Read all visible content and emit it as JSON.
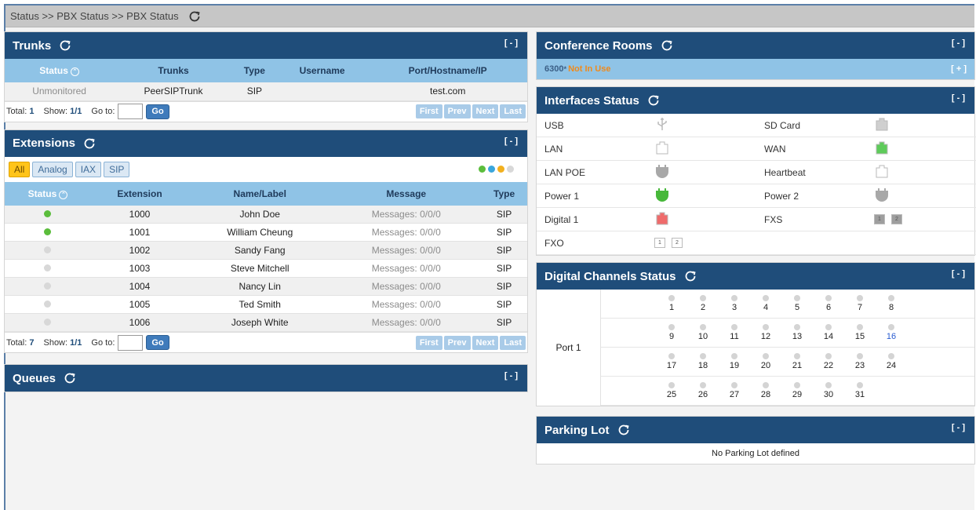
{
  "breadcrumb": "Status >> PBX Status >> PBX Status",
  "toggle_collapse": "[ - ]",
  "toggle_expand": "[ + ]",
  "trunks": {
    "title": "Trunks",
    "columns": [
      "Status",
      "Trunks",
      "Type",
      "Username",
      "Port/Hostname/IP"
    ],
    "rows": [
      [
        "Unmonitored",
        "PeerSIPTrunk",
        "SIP",
        "",
        "test.com"
      ]
    ],
    "total_label": "Total:",
    "total": "1",
    "show_label": "Show:",
    "show": "1/1",
    "goto_label": "Go to:",
    "go": "Go",
    "nav": [
      "First",
      "Prev",
      "Next",
      "Last"
    ]
  },
  "extensions": {
    "title": "Extensions",
    "filters": [
      "All",
      "Analog",
      "IAX",
      "SIP"
    ],
    "legend_colors": [
      "#5bbd3c",
      "#3aa6dc",
      "#f2b01e",
      "#d8d8d8"
    ],
    "columns": [
      "Status",
      "Extension",
      "Name/Label",
      "Message",
      "Type"
    ],
    "rows": [
      {
        "status": "on",
        "ext": "1000",
        "name": "John Doe",
        "msg_label": "Messages:",
        "msg": "0/0/0",
        "type": "SIP"
      },
      {
        "status": "on",
        "ext": "1001",
        "name": "William Cheung",
        "msg_label": "Messages:",
        "msg": "0/0/0",
        "type": "SIP"
      },
      {
        "status": "off",
        "ext": "1002",
        "name": "Sandy Fang",
        "msg_label": "Messages:",
        "msg": "0/0/0",
        "type": "SIP"
      },
      {
        "status": "off",
        "ext": "1003",
        "name": "Steve Mitchell",
        "msg_label": "Messages:",
        "msg": "0/0/0",
        "type": "SIP"
      },
      {
        "status": "off",
        "ext": "1004",
        "name": "Nancy Lin",
        "msg_label": "Messages:",
        "msg": "0/0/0",
        "type": "SIP"
      },
      {
        "status": "off",
        "ext": "1005",
        "name": "Ted Smith",
        "msg_label": "Messages:",
        "msg": "0/0/0",
        "type": "SIP"
      },
      {
        "status": "off",
        "ext": "1006",
        "name": "Joseph White",
        "msg_label": "Messages:",
        "msg": "0/0/0",
        "type": "SIP"
      }
    ],
    "total_label": "Total:",
    "total": "7",
    "show_label": "Show:",
    "show": "1/1",
    "goto_label": "Go to:",
    "go": "Go",
    "nav": [
      "First",
      "Prev",
      "Next",
      "Last"
    ]
  },
  "queues": {
    "title": "Queues"
  },
  "conference": {
    "title": "Conference Rooms",
    "room": "6300",
    "mark": "*",
    "status": "Not In Use"
  },
  "interfaces": {
    "title": "Interfaces Status",
    "items": [
      {
        "label": "USB",
        "icon": "usb-icon",
        "color": "#bbbbbb"
      },
      {
        "label": "SD Card",
        "icon": "sd-card-icon",
        "color": "#cfcfcf"
      },
      {
        "label": "LAN",
        "icon": "lan-port-icon",
        "color": "#ffffff"
      },
      {
        "label": "WAN",
        "icon": "wan-port-icon",
        "color": "#5ecb5a"
      },
      {
        "label": "LAN POE",
        "icon": "plug-icon",
        "color": "#a8a8a8"
      },
      {
        "label": "Heartbeat",
        "icon": "heartbeat-port-icon",
        "color": "#ffffff"
      },
      {
        "label": "Power 1",
        "icon": "plug-icon",
        "color": "#47b83a"
      },
      {
        "label": "Power 2",
        "icon": "plug-icon",
        "color": "#a8a8a8"
      },
      {
        "label": "Digital 1",
        "icon": "digital-port-icon",
        "color": "#ef6b6b"
      },
      {
        "label": "FXS",
        "icon": "fxs-port-icon",
        "ports": [
          "1",
          "2"
        ],
        "filled": true
      },
      {
        "label": "FXO",
        "icon": "fxo-port-icon",
        "ports": [
          "1",
          "2"
        ],
        "filled": false
      }
    ]
  },
  "digital_channels": {
    "title": "Digital Channels Status",
    "port": "Port 1",
    "rows": [
      [
        "1",
        "2",
        "3",
        "4",
        "5",
        "6",
        "7",
        "8"
      ],
      [
        "9",
        "10",
        "11",
        "12",
        "13",
        "14",
        "15",
        "16"
      ],
      [
        "17",
        "18",
        "19",
        "20",
        "21",
        "22",
        "23",
        "24"
      ],
      [
        "25",
        "26",
        "27",
        "28",
        "29",
        "30",
        "31"
      ]
    ],
    "highlight": "16"
  },
  "parking": {
    "title": "Parking Lot",
    "message": "No Parking Lot defined"
  }
}
